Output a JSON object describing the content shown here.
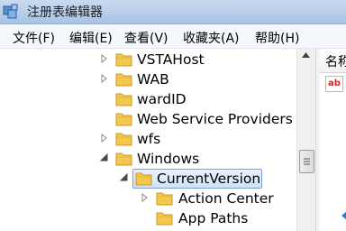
{
  "window": {
    "title": "注册表编辑器"
  },
  "menu": [
    {
      "label": "文件(F)"
    },
    {
      "label": "编辑(E)"
    },
    {
      "label": "查看(V)"
    },
    {
      "label": "收藏夹(A)"
    },
    {
      "label": "帮助(H)"
    }
  ],
  "tree": {
    "items": [
      {
        "label": "VSTAHost",
        "expander": "collapsed"
      },
      {
        "label": "WAB",
        "expander": "collapsed"
      },
      {
        "label": "wardID",
        "expander": "none"
      },
      {
        "label": "Web Service Providers",
        "expander": "none"
      },
      {
        "label": "wfs",
        "expander": "collapsed"
      },
      {
        "label": "Windows",
        "expander": "expanded"
      },
      {
        "label": "CurrentVersion",
        "expander": "expanded",
        "selected": true
      },
      {
        "label": "Action Center",
        "expander": "collapsed"
      },
      {
        "label": "App Paths",
        "expander": "none"
      }
    ]
  },
  "right_pane": {
    "column_header": "名称",
    "value_icon": "ab",
    "icon_name": "string-value-icon"
  },
  "colors": {
    "folder": "#f2c94c",
    "selection_border": "#7da2ce",
    "title_bar": "#b8cfeb"
  }
}
